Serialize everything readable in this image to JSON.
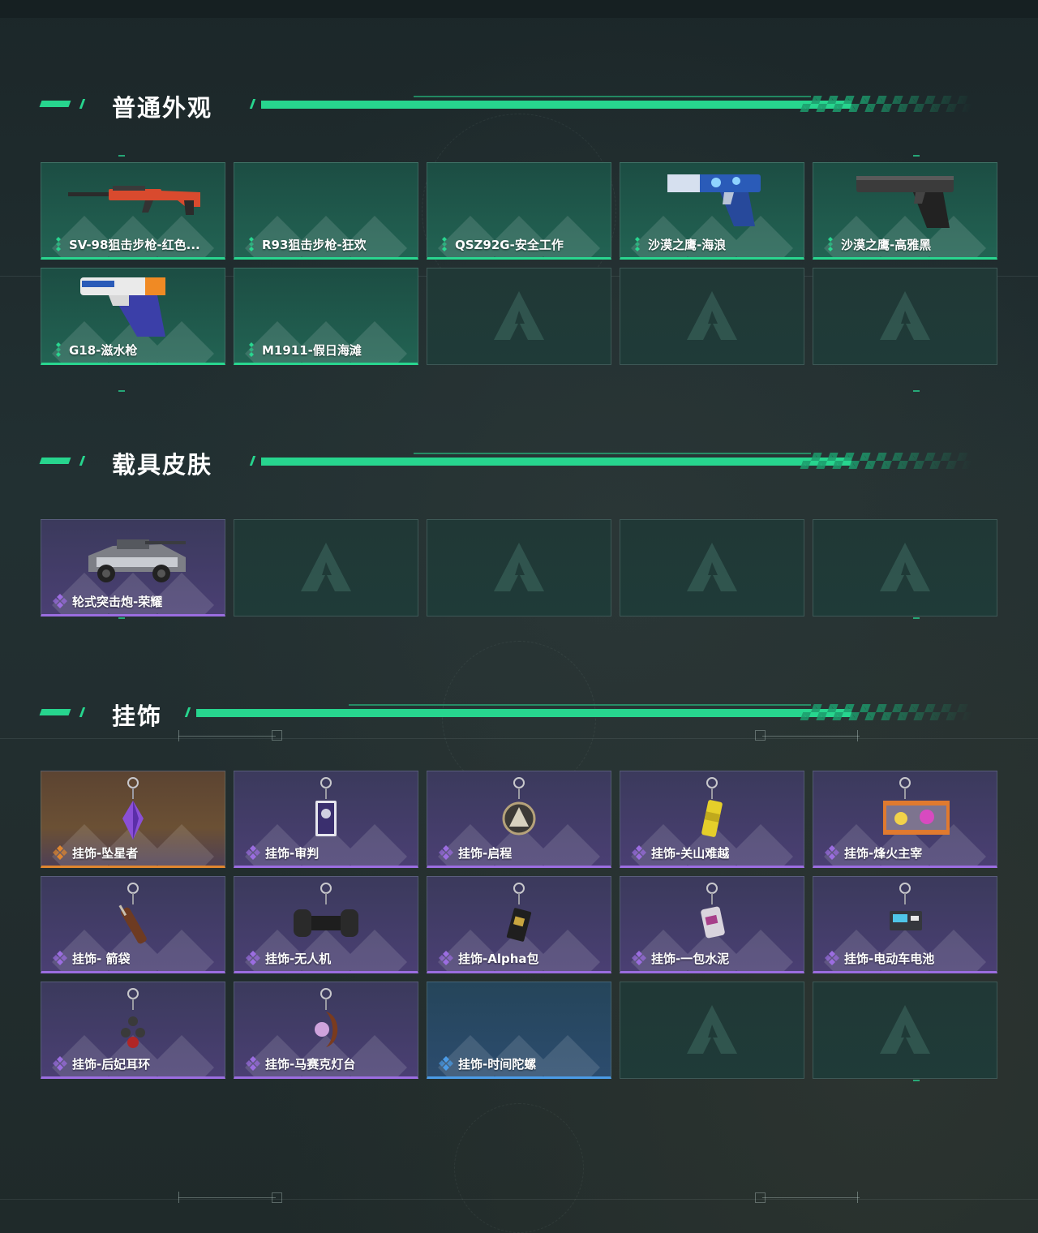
{
  "colors": {
    "accent_green": "#27d58e",
    "rarity_green": "#29d68f",
    "rarity_purple": "#9b6de0",
    "rarity_orange": "#e0862f",
    "rarity_blue": "#4b9be6"
  },
  "sections": [
    {
      "title": "普通外观",
      "items": [
        {
          "name": "SV-98狙击步枪-红色...",
          "rarity": "green",
          "icon": "sniper-rifle-icon"
        },
        {
          "name": "R93狙击步枪-狂欢",
          "rarity": "green",
          "icon": ""
        },
        {
          "name": "QSZ92G-安全工作",
          "rarity": "green",
          "icon": ""
        },
        {
          "name": "沙漠之鹰-海浪",
          "rarity": "green",
          "icon": "pistol-blue-icon"
        },
        {
          "name": "沙漠之鹰-高雅黑",
          "rarity": "green",
          "icon": "pistol-black-icon"
        },
        {
          "name": "G18-滋水枪",
          "rarity": "green",
          "icon": "water-pistol-icon"
        },
        {
          "name": "M1911-假日海滩",
          "rarity": "green",
          "icon": ""
        },
        {
          "name": "",
          "rarity": "empty"
        },
        {
          "name": "",
          "rarity": "empty"
        },
        {
          "name": "",
          "rarity": "empty"
        }
      ]
    },
    {
      "title": "载具皮肤",
      "items": [
        {
          "name": "轮式突击炮-荣耀",
          "rarity": "purple",
          "icon": "armored-vehicle-icon"
        },
        {
          "name": "",
          "rarity": "empty"
        },
        {
          "name": "",
          "rarity": "empty"
        },
        {
          "name": "",
          "rarity": "empty"
        },
        {
          "name": "",
          "rarity": "empty"
        }
      ]
    },
    {
      "title": "挂饰",
      "items": [
        {
          "name": "挂饰-坠星者",
          "rarity": "orange",
          "icon": "crystal-charm-icon"
        },
        {
          "name": "挂饰-审判",
          "rarity": "purple",
          "icon": "card-charm-icon"
        },
        {
          "name": "挂饰-启程",
          "rarity": "purple",
          "icon": "medal-charm-icon"
        },
        {
          "name": "挂饰-关山难越",
          "rarity": "purple",
          "icon": "can-charm-icon"
        },
        {
          "name": "挂饰-烽火主宰",
          "rarity": "purple",
          "icon": "container-charm-icon"
        },
        {
          "name": "挂饰- 箭袋",
          "rarity": "purple",
          "icon": "quiver-charm-icon"
        },
        {
          "name": "挂饰-无人机",
          "rarity": "purple",
          "icon": "drone-charm-icon"
        },
        {
          "name": "挂饰-Alpha包",
          "rarity": "purple",
          "icon": "pack-charm-icon"
        },
        {
          "name": "挂饰-一包水泥",
          "rarity": "purple",
          "icon": "cement-bag-charm-icon"
        },
        {
          "name": "挂饰-电动车电池",
          "rarity": "purple",
          "icon": "battery-charm-icon"
        },
        {
          "name": "挂饰-后妃耳环",
          "rarity": "purple",
          "icon": "earring-charm-icon"
        },
        {
          "name": "挂饰-马赛克灯台",
          "rarity": "purple",
          "icon": "lamp-charm-icon"
        },
        {
          "name": "挂饰-时间陀螺",
          "rarity": "blue",
          "icon": ""
        },
        {
          "name": "",
          "rarity": "empty"
        },
        {
          "name": "",
          "rarity": "empty"
        }
      ]
    }
  ]
}
